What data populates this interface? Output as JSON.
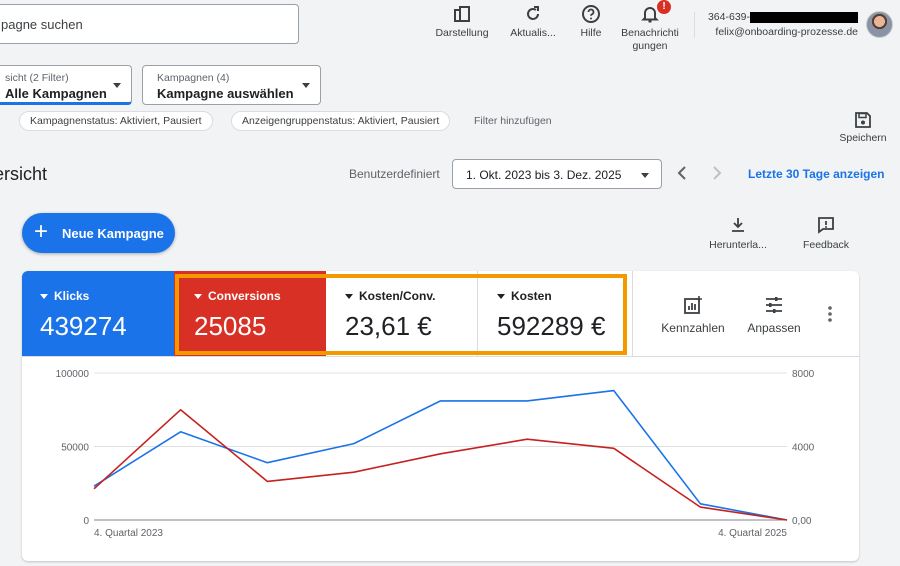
{
  "search": {
    "placeholder": "pagne suchen"
  },
  "toolbar": {
    "view": "Darstellung",
    "refresh": "Aktualis...",
    "help": "Hilfe",
    "notifications_line1": "Benachrichti",
    "notifications_line2": "gungen",
    "notifications_badge": "!"
  },
  "account": {
    "id_prefix": "364-639-",
    "email": "felix@onboarding-prozesse.de"
  },
  "filters": {
    "campaigns_small": "sicht (2 Filter)",
    "campaigns_value": "Alle Kampagnen",
    "campaign_select_small": "Kampagnen (4)",
    "campaign_select_value": "Kampagne auswählen",
    "chip_campaign_status": "Kampagnenstatus: Aktiviert, Pausiert",
    "chip_adgroup_status": "Anzeigengruppenstatus: Aktiviert, Pausiert",
    "add_filter": "Filter hinzufügen",
    "save": "Speichern"
  },
  "page": {
    "title": "ersicht",
    "date_label": "Benutzerdefiniert",
    "date_range": "1. Okt. 2023 bis 3. Dez. 2025",
    "last30": "Letzte 30 Tage anzeigen"
  },
  "actions": {
    "new_campaign": "Neue Kampagne",
    "download": "Herunterla...",
    "feedback": "Feedback"
  },
  "metrics": [
    {
      "name": "Klicks",
      "value": "439274",
      "color": "#1a73e8"
    },
    {
      "name": "Conversions",
      "value": "25085",
      "color": "#d93025"
    },
    {
      "name": "Kosten/Conv.",
      "value": "23,61 €"
    },
    {
      "name": "Kosten",
      "value": "592289 €"
    }
  ],
  "card_tools": {
    "metrics_label": "Kennzahlen",
    "adjust_label": "Anpassen"
  },
  "chart_data": {
    "type": "line",
    "x_labels": [
      "4. Quartal 2023",
      "4. Quartal 2025"
    ],
    "left_ticks": [
      "100000",
      "50000",
      "0"
    ],
    "right_ticks": [
      "8000",
      "4000",
      "0,00"
    ],
    "ylim_left": [
      0,
      100000
    ],
    "ylim_right": [
      0,
      8000
    ],
    "series": [
      {
        "axis": "left",
        "color": "#1a73e8",
        "values": [
          23000,
          60000,
          39000,
          52000,
          81000,
          81000,
          88000,
          11000,
          0
        ]
      },
      {
        "axis": "right",
        "color": "#c5221f",
        "values": [
          1700,
          6000,
          2100,
          2600,
          3600,
          4400,
          3900,
          700,
          0
        ]
      }
    ]
  }
}
